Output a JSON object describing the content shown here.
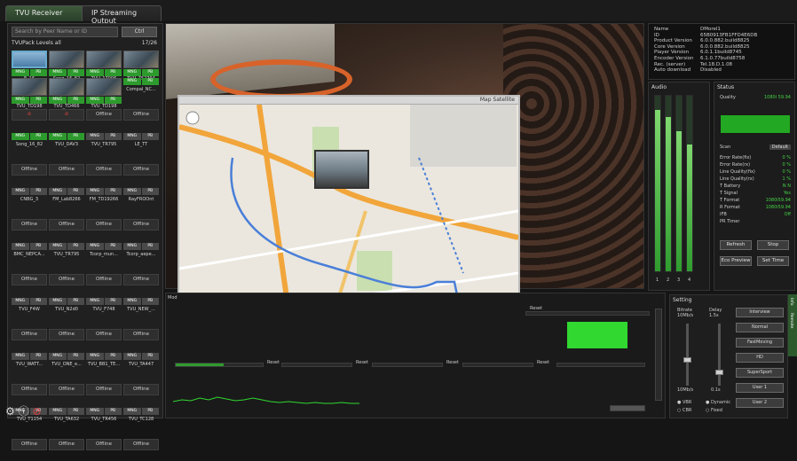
{
  "tabs": {
    "receiver": "TVU Receiver",
    "ip_output": "IP Streaming Output"
  },
  "left": {
    "search_placeholder": "Search by Peer Name or ID",
    "search_button": "Ctrl",
    "header": "TVUPack    Levels all",
    "header_right": "17/26",
    "tiles": [
      {
        "s1": "MNG",
        "s2": "PB",
        "s1c": "g",
        "s2c": "g",
        "name": "E_16",
        "body": "",
        "thumb": true,
        "sel": true
      },
      {
        "s1": "MNG",
        "s2": "PB",
        "s1c": "g",
        "s2c": "g",
        "name": "Song_16_82",
        "body": "",
        "thumb": true
      },
      {
        "s1": "MNG",
        "s2": "PB",
        "s1c": "g",
        "s2c": "g",
        "name": "TVU_17006",
        "body": "",
        "thumb": true
      },
      {
        "s1": "MNG",
        "s2": "PB",
        "s1c": "g",
        "s2c": "g",
        "name": "TVU_752794",
        "body": "",
        "thumb": true
      },
      {
        "s1": "MNG",
        "s2": "PB",
        "s1c": "g",
        "s2c": "g",
        "name": "TVU_TD198",
        "body": "",
        "thumb": true
      },
      {
        "s1": "MNG",
        "s2": "PB",
        "s1c": "g",
        "s2c": "g",
        "name": "TVU_TD466",
        "body": "",
        "thumb": true
      },
      {
        "s1": "MNG",
        "s2": "PB",
        "s1c": "g",
        "s2c": "g",
        "name": "TVU_TD198",
        "body": "",
        "thumb": true
      },
      {
        "s1": "MNG",
        "s2": "PB",
        "s1c": "g",
        "s2c": "g",
        "name": "Compal_NC...",
        "body": "",
        "thumb": false
      },
      {
        "s1": "",
        "s2": "",
        "s1c": "x",
        "s2c": "x",
        "name": "",
        "body": "",
        "thumb": false
      },
      {
        "s1": "",
        "s2": "",
        "s1c": "x",
        "s2c": "x",
        "name": "",
        "body": "",
        "thumb": false
      },
      {
        "s1": "",
        "s2": "",
        "s1c": "x",
        "s2c": "x",
        "name": "",
        "body": "Offline",
        "thumb": false
      },
      {
        "s1": "",
        "s2": "",
        "s1c": "x",
        "s2c": "x",
        "name": "",
        "body": "Offline",
        "thumb": false
      },
      {
        "s1": "MNG",
        "s2": "PB",
        "s1c": "g",
        "s2c": "g",
        "name": "Song_16_82",
        "body": "",
        "thumb": false
      },
      {
        "s1": "MNG",
        "s2": "PB",
        "s1c": "g",
        "s2c": "g",
        "name": "TVU_DAV3",
        "body": "",
        "thumb": false
      },
      {
        "s1": "MNG",
        "s2": "PB",
        "s1c": "y",
        "s2c": "y",
        "name": "TVU_TR795",
        "body": "",
        "thumb": false
      },
      {
        "s1": "MNG",
        "s2": "PB",
        "s1c": "y",
        "s2c": "y",
        "name": "LE_TT",
        "body": "",
        "thumb": false
      },
      {
        "s1": "",
        "s2": "",
        "s1c": "x",
        "s2c": "x",
        "name": "",
        "body": "Offline",
        "thumb": false
      },
      {
        "s1": "",
        "s2": "",
        "s1c": "x",
        "s2c": "x",
        "name": "",
        "body": "Offline",
        "thumb": false
      },
      {
        "s1": "",
        "s2": "",
        "s1c": "x",
        "s2c": "x",
        "name": "",
        "body": "Offline",
        "thumb": false
      },
      {
        "s1": "",
        "s2": "",
        "s1c": "x",
        "s2c": "x",
        "name": "",
        "body": "Offline",
        "thumb": false
      },
      {
        "s1": "MNG",
        "s2": "PB",
        "s1c": "y",
        "s2c": "y",
        "name": "CNBG_3",
        "body": "",
        "thumb": false
      },
      {
        "s1": "MNG",
        "s2": "PB",
        "s1c": "y",
        "s2c": "y",
        "name": "FM_Lab8266",
        "body": "",
        "thumb": false
      },
      {
        "s1": "MNG",
        "s2": "PB",
        "s1c": "y",
        "s2c": "y",
        "name": "FM_TD19266",
        "body": "",
        "thumb": false
      },
      {
        "s1": "MNG",
        "s2": "PB",
        "s1c": "y",
        "s2c": "y",
        "name": "RayFROOnt",
        "body": "",
        "thumb": false
      },
      {
        "s1": "",
        "s2": "",
        "s1c": "x",
        "s2c": "x",
        "name": "",
        "body": "Offline",
        "thumb": false
      },
      {
        "s1": "",
        "s2": "",
        "s1c": "x",
        "s2c": "x",
        "name": "",
        "body": "Offline",
        "thumb": false
      },
      {
        "s1": "",
        "s2": "",
        "s1c": "x",
        "s2c": "x",
        "name": "",
        "body": "Offline",
        "thumb": false
      },
      {
        "s1": "",
        "s2": "",
        "s1c": "x",
        "s2c": "x",
        "name": "",
        "body": "Offline",
        "thumb": false
      },
      {
        "s1": "MNG",
        "s2": "PB",
        "s1c": "y",
        "s2c": "y",
        "name": "BMC_NEPCA...",
        "body": "",
        "thumb": false
      },
      {
        "s1": "MNG",
        "s2": "PB",
        "s1c": "y",
        "s2c": "y",
        "name": "TVU_TR795",
        "body": "",
        "thumb": false
      },
      {
        "s1": "MNG",
        "s2": "PB",
        "s1c": "y",
        "s2c": "y",
        "name": "Tcorp_mun...",
        "body": "",
        "thumb": false
      },
      {
        "s1": "MNG",
        "s2": "PB",
        "s1c": "y",
        "s2c": "y",
        "name": "Tcorp_aepe...",
        "body": "",
        "thumb": false
      },
      {
        "s1": "",
        "s2": "",
        "s1c": "x",
        "s2c": "x",
        "name": "",
        "body": "Offline",
        "thumb": false
      },
      {
        "s1": "",
        "s2": "",
        "s1c": "x",
        "s2c": "x",
        "name": "",
        "body": "Offline",
        "thumb": false
      },
      {
        "s1": "",
        "s2": "",
        "s1c": "x",
        "s2c": "x",
        "name": "",
        "body": "Offline",
        "thumb": false
      },
      {
        "s1": "",
        "s2": "",
        "s1c": "x",
        "s2c": "x",
        "name": "",
        "body": "Offline",
        "thumb": false
      },
      {
        "s1": "MNG",
        "s2": "PB",
        "s1c": "y",
        "s2c": "y",
        "name": "TVU_F4W",
        "body": "",
        "thumb": false
      },
      {
        "s1": "MNG",
        "s2": "PB",
        "s1c": "y",
        "s2c": "y",
        "name": "TVU_N2d0",
        "body": "",
        "thumb": false
      },
      {
        "s1": "MNG",
        "s2": "PB",
        "s1c": "y",
        "s2c": "y",
        "name": "TVU_F748",
        "body": "",
        "thumb": false
      },
      {
        "s1": "MNG",
        "s2": "PB",
        "s1c": "y",
        "s2c": "y",
        "name": "TVU_NEW_...",
        "body": "",
        "thumb": false
      },
      {
        "s1": "",
        "s2": "",
        "s1c": "x",
        "s2c": "x",
        "name": "",
        "body": "Offline",
        "thumb": false
      },
      {
        "s1": "",
        "s2": "",
        "s1c": "x",
        "s2c": "x",
        "name": "",
        "body": "Offline",
        "thumb": false
      },
      {
        "s1": "",
        "s2": "",
        "s1c": "x",
        "s2c": "x",
        "name": "",
        "body": "Offline",
        "thumb": false
      },
      {
        "s1": "",
        "s2": "",
        "s1c": "x",
        "s2c": "x",
        "name": "",
        "body": "Offline",
        "thumb": false
      },
      {
        "s1": "MNG",
        "s2": "PB",
        "s1c": "y",
        "s2c": "y",
        "name": "TVU_WATT...",
        "body": "",
        "thumb": false
      },
      {
        "s1": "MNG",
        "s2": "PB",
        "s1c": "y",
        "s2c": "y",
        "name": "TVU_ONE_e...",
        "body": "",
        "thumb": false
      },
      {
        "s1": "MNG",
        "s2": "PB",
        "s1c": "y",
        "s2c": "y",
        "name": "TVU_BB1_TE...",
        "body": "",
        "thumb": false
      },
      {
        "s1": "MNG",
        "s2": "PB",
        "s1c": "y",
        "s2c": "y",
        "name": "TVU_TA447",
        "body": "",
        "thumb": false
      },
      {
        "s1": "",
        "s2": "",
        "s1c": "x",
        "s2c": "x",
        "name": "",
        "body": "Offline",
        "thumb": false
      },
      {
        "s1": "",
        "s2": "",
        "s1c": "x",
        "s2c": "x",
        "name": "",
        "body": "Offline",
        "thumb": false
      },
      {
        "s1": "",
        "s2": "",
        "s1c": "x",
        "s2c": "x",
        "name": "",
        "body": "Offline",
        "thumb": false
      },
      {
        "s1": "",
        "s2": "",
        "s1c": "x",
        "s2c": "x",
        "name": "",
        "body": "Offline",
        "thumb": false
      },
      {
        "s1": "MNG",
        "s2": "PB",
        "s1c": "y",
        "s2c": "y",
        "name": "TVU_T1154",
        "body": "",
        "thumb": false
      },
      {
        "s1": "MNG",
        "s2": "PB",
        "s1c": "y",
        "s2c": "y",
        "name": "TVU_TA632",
        "body": "",
        "thumb": false
      },
      {
        "s1": "MNG",
        "s2": "PB",
        "s1c": "y",
        "s2c": "y",
        "name": "TVU_TR456",
        "body": "",
        "thumb": false
      },
      {
        "s1": "MNG",
        "s2": "PB",
        "s1c": "y",
        "s2c": "y",
        "name": "TVU_TC128",
        "body": "",
        "thumb": false
      },
      {
        "s1": "",
        "s2": "",
        "s1c": "x",
        "s2c": "x",
        "name": "",
        "body": "Offline",
        "thumb": false
      },
      {
        "s1": "",
        "s2": "",
        "s1c": "x",
        "s2c": "x",
        "name": "",
        "body": "Offline",
        "thumb": false
      },
      {
        "s1": "",
        "s2": "",
        "s1c": "x",
        "s2c": "x",
        "name": "",
        "body": "Offline",
        "thumb": false
      },
      {
        "s1": "",
        "s2": "",
        "s1c": "x",
        "s2c": "x",
        "name": "",
        "body": "Offline",
        "thumb": false
      }
    ]
  },
  "info": [
    [
      "Name",
      "DMorel1"
    ],
    [
      "ID",
      "65B0913FB1FFD4E6DB"
    ],
    [
      "Product Version",
      "6.0.0.882.build8825"
    ],
    [
      "Core Version",
      "6.0.0.882.build8825"
    ],
    [
      "Player Version",
      "6.0.1.1build8745"
    ],
    [
      "Encoder Version",
      "6.1.0.77build8758"
    ],
    [
      "Rec. (server)",
      "Tel.18.D.1.08"
    ],
    [
      "Auto download",
      "Disabled"
    ]
  ],
  "audio": {
    "title": "Audio",
    "levels": [
      0.92,
      0.88,
      0.8,
      0.72
    ],
    "channel_labels": [
      "1",
      "2",
      "3",
      "4"
    ]
  },
  "status": {
    "title": "Status",
    "quality_label": "Quality",
    "quality_value": "1080i 59.94",
    "scan_label": "Scan",
    "scan_value": "Default",
    "rows": [
      [
        "Error Rate(fix)",
        "0 %"
      ],
      [
        "Error Rate(rx)",
        "0 %"
      ],
      [
        "Line Quality(fix)",
        "0 %"
      ],
      [
        "Line Quality(rx)",
        "1 %"
      ],
      [
        "T Battery",
        "N     N"
      ],
      [
        "T Signal",
        "Yes"
      ],
      [
        "T Format",
        "1080i59.94"
      ],
      [
        "R Format",
        "1080i59.94"
      ],
      [
        "IFB",
        "Off"
      ],
      [
        "PR Timer",
        ""
      ]
    ],
    "buttons": {
      "refresh": "Refresh",
      "stop": "Stop",
      "eco_preview": "Eco Preview",
      "set_time": "Set Time"
    }
  },
  "bottom": {
    "reset": "Reset",
    "label": "Mod"
  },
  "setting": {
    "title": "Setting",
    "bitrate_label": "Bitrate 10Mb/s",
    "delay_label": "Delay 1.5s",
    "bitrate_value": "10Mb/s",
    "delay_value": "0.1s",
    "opt1": "VBR",
    "opt2": "CBR",
    "opt3": "Dynamic",
    "opt4": "Fixed",
    "buttons": [
      "Interview",
      "Normal",
      "FastMoving",
      "HD",
      "SuperSport",
      "User 1",
      "User 2"
    ],
    "side_tabs": [
      "Info",
      "Remote"
    ]
  },
  "map": {
    "bar_text": "Map  Satellite"
  },
  "colors": {
    "green": "#2d9a2d",
    "accent": "#44d044"
  }
}
